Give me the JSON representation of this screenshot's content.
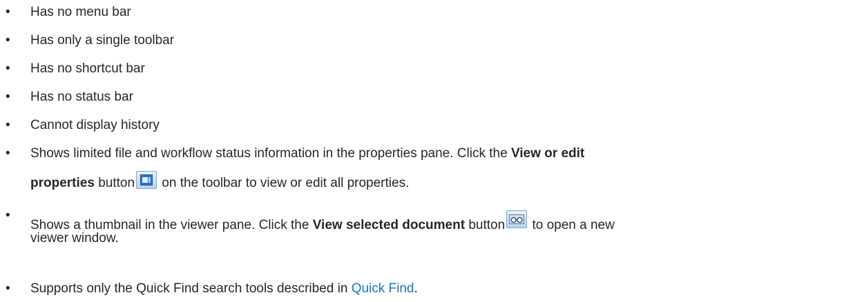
{
  "items": [
    {
      "text": "Has no menu bar"
    },
    {
      "text": "Has only a single toolbar"
    },
    {
      "text": "Has no shortcut bar"
    },
    {
      "text": "Has no status bar"
    },
    {
      "text": "Cannot display history"
    },
    {
      "pre": "Shows limited file and workflow status information in the properties pane. Click the ",
      "bold1": "View or edit",
      "bold2": "properties",
      "mid": " button",
      "post": " on the toolbar to view or edit all properties.",
      "icon": "view-properties-icon"
    },
    {
      "pre": "Shows a thumbnail in the viewer pane. Click the ",
      "bold": "View selected document",
      "mid": " button",
      "post": " to open a new",
      "line2": "viewer window.",
      "icon": "view-document-glasses-icon"
    },
    {
      "pre": "Supports only the Quick Find search tools described in ",
      "link": "Quick Find",
      "post": "."
    }
  ],
  "bullet": "•",
  "colors": {
    "text": "#262626",
    "link": "#1a73c9"
  }
}
